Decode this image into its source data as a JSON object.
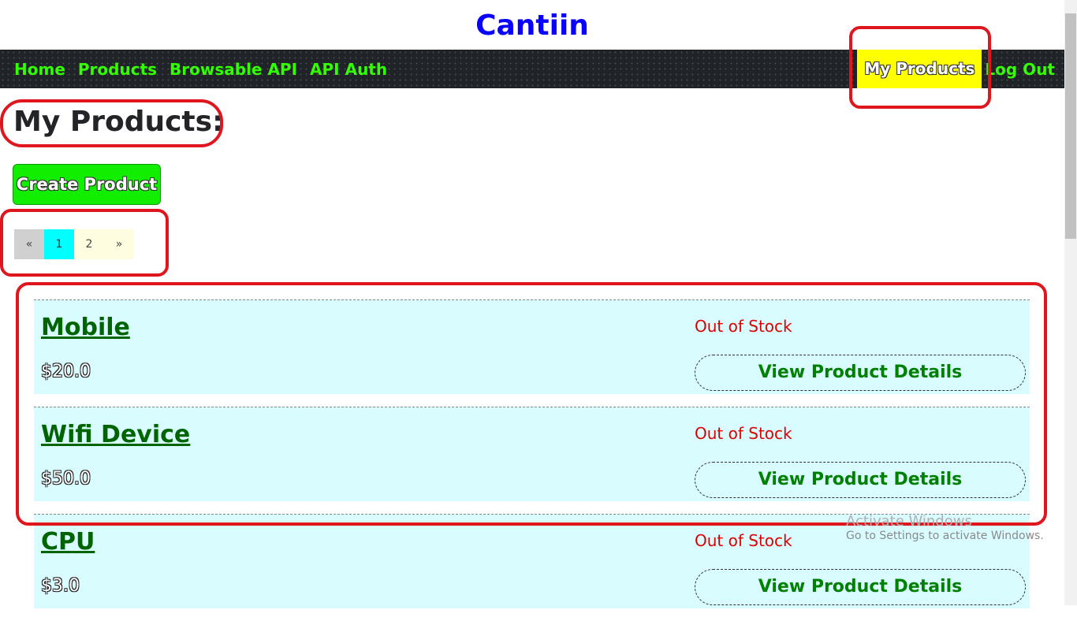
{
  "site": {
    "title": "Cantiin"
  },
  "nav": {
    "left": [
      {
        "label": "Home"
      },
      {
        "label": "Products"
      },
      {
        "label": "Browsable API"
      },
      {
        "label": "API Auth"
      }
    ],
    "active_label": "My Products",
    "logout_label": "Log Out"
  },
  "page": {
    "heading": "My Products:",
    "create_label": "Create Product"
  },
  "pagination": {
    "prev": "«",
    "pages": [
      "1",
      "2"
    ],
    "current": "1",
    "next": "»"
  },
  "products": [
    {
      "name": "Mobile",
      "price": "$20.0",
      "status": "Out of Stock",
      "action": "View Product Details"
    },
    {
      "name": "Wifi Device",
      "price": "$50.0",
      "status": "Out of Stock",
      "action": "View Product Details"
    },
    {
      "name": "CPU",
      "price": "$3.0",
      "status": "Out of Stock",
      "action": "View Product Details"
    }
  ],
  "watermark": {
    "title": "Activate Windows",
    "subtitle": "Go to Settings to activate Windows."
  },
  "colors": {
    "title": "#0a00ff",
    "nav_link": "#33ff00",
    "active_tab": "#ffff00",
    "create_button": "#12ee00",
    "card_background": "#d8fcff",
    "out_of_stock": "#e00000",
    "annotation": "#e0161f"
  }
}
